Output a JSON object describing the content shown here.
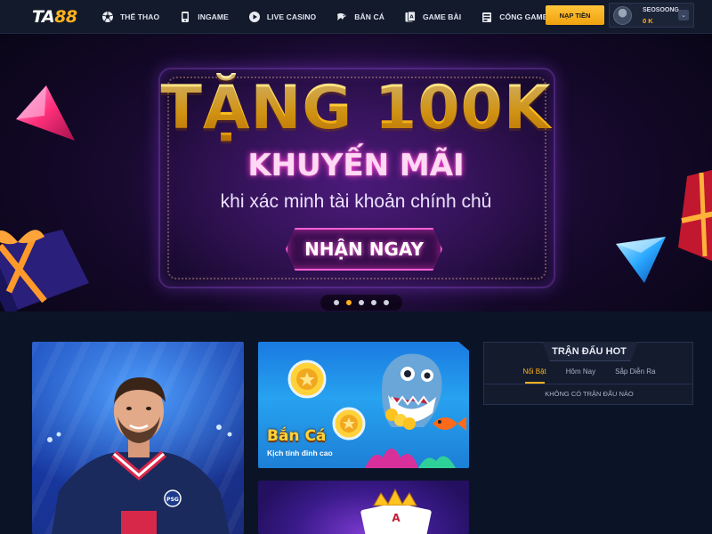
{
  "brand": {
    "logo_text": "TA",
    "logo_num": "88"
  },
  "nav": {
    "items": [
      {
        "label": "THỂ THAO",
        "icon": "soccer-ball-icon"
      },
      {
        "label": "INGAME",
        "icon": "mobile-game-icon"
      },
      {
        "label": "LIVE CASINO",
        "icon": "live-play-icon"
      },
      {
        "label": "BẮN CÁ",
        "icon": "fish-icon"
      },
      {
        "label": "GAME BÀI",
        "icon": "cards-icon"
      },
      {
        "label": "CỔNG GAMES",
        "icon": "game-portal-icon",
        "has_dropdown": true
      }
    ]
  },
  "account": {
    "deposit_label": "NẠP TIỀN",
    "username": "SEOSOONG",
    "balance": "0 K"
  },
  "banner": {
    "headline": "TẶNG 100K",
    "subheadline": "KHUYẾN MÃI",
    "tagline": "khi xác minh tài khoản chính chủ",
    "cta_label": "NHẬN NGAY",
    "slides_count": 5,
    "active_slide": 2
  },
  "promos": {
    "fishing": {
      "title": "Bắn Cá",
      "subtitle": "Kịch tính đỉnh cao"
    }
  },
  "hot_matches": {
    "title": "TRẬN ĐẤU HOT",
    "tabs": [
      "Nổi Bật",
      "Hôm Nay",
      "Sắp Diễn Ra"
    ],
    "active_tab": 0,
    "empty_text": "KHÔNG CÓ TRẬN ĐẤU NÀO"
  },
  "colors": {
    "background": "#0b1426",
    "topbar": "#131a2b",
    "accent": "#ffb21c",
    "neon_pink": "#ff5fd8"
  }
}
